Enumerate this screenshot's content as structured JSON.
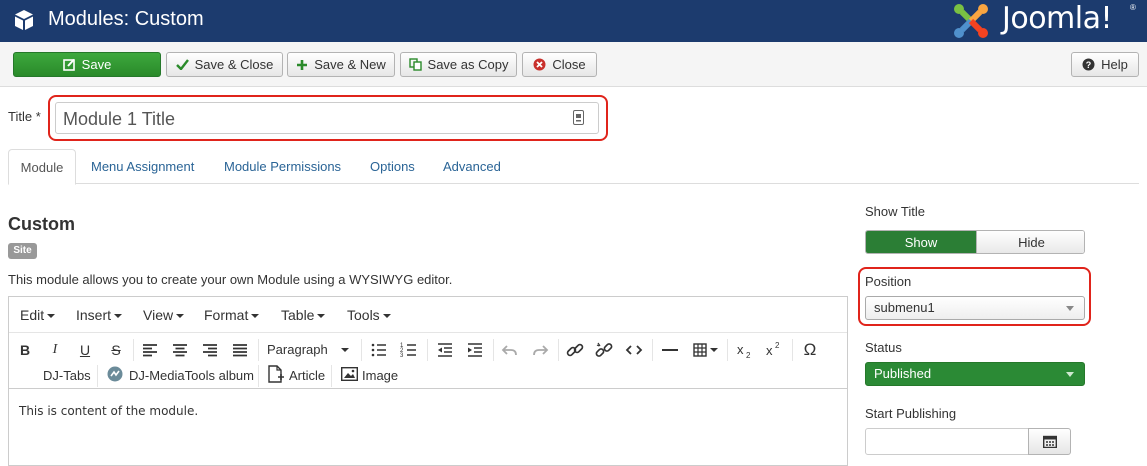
{
  "header": {
    "title": "Modules: Custom",
    "logo_text": "Joomla!",
    "logo_mark": "®",
    "colors": {
      "bar": "#1c3b6e"
    }
  },
  "toolbar": {
    "save": "Save",
    "save_close": "Save & Close",
    "save_new": "Save & New",
    "save_copy": "Save as Copy",
    "close": "Close",
    "help": "Help",
    "icons": [
      "edit-icon",
      "check-icon",
      "plus-icon",
      "copy-icon",
      "close-circle-icon",
      "help-icon"
    ]
  },
  "form": {
    "title_label": "Title",
    "required_mark": "*",
    "title_value": "Module 1 Title"
  },
  "tabs": [
    {
      "label": "Module",
      "active": true
    },
    {
      "label": "Menu Assignment",
      "active": false
    },
    {
      "label": "Module Permissions",
      "active": false
    },
    {
      "label": "Options",
      "active": false
    },
    {
      "label": "Advanced",
      "active": false
    }
  ],
  "module": {
    "heading": "Custom",
    "badge": "Site",
    "description": "This module allows you to create your own Module using a WYSIWYG editor."
  },
  "editor": {
    "menus": [
      "Edit",
      "Insert",
      "View",
      "Format",
      "Table",
      "Tools"
    ],
    "block_format": "Paragraph",
    "plugins": [
      "DJ-Tabs",
      "DJ-MediaTools album",
      "Article",
      "Image"
    ],
    "content": "This is content of the module."
  },
  "sidebar": {
    "show_title_label": "Show Title",
    "show_option": "Show",
    "hide_option": "Hide",
    "show_selected": "Show",
    "position_label": "Position",
    "position_value": "submenu1",
    "status_label": "Status",
    "status_value": "Published",
    "start_publishing_label": "Start Publishing",
    "start_publishing_value": ""
  },
  "highlights": {
    "color": "#e0241b",
    "items": [
      "title-field",
      "position-field"
    ]
  }
}
